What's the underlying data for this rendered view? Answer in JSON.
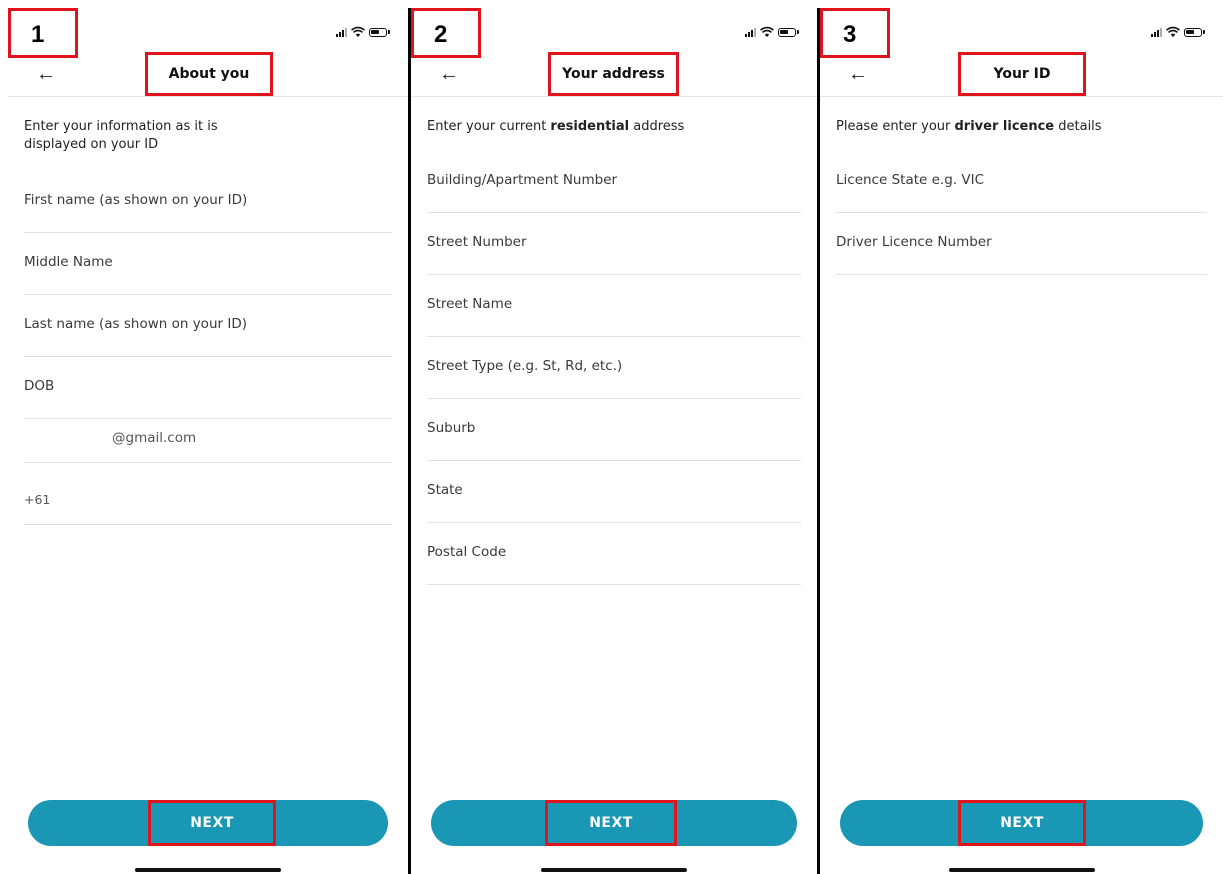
{
  "panels": [
    {
      "step": "1",
      "title": "About you",
      "intro": "Enter your information as it is displayed on your ID",
      "fields": [
        {
          "placeholder": "First name (as shown on your ID)"
        },
        {
          "placeholder": "Middle Name"
        },
        {
          "placeholder": "Last name (as shown on your ID)"
        },
        {
          "placeholder": "DOB"
        },
        {
          "value": "@gmail.com"
        },
        {
          "value": "+61"
        }
      ],
      "button": "NEXT"
    },
    {
      "step": "2",
      "title": "Your address",
      "intro_pre": "Enter your current ",
      "intro_bold": "residential",
      "intro_post": " address",
      "fields": [
        {
          "placeholder": "Building/Apartment Number"
        },
        {
          "placeholder": "Street Number"
        },
        {
          "placeholder": "Street Name"
        },
        {
          "placeholder": "Street Type (e.g. St, Rd, etc.)"
        },
        {
          "placeholder": "Suburb"
        },
        {
          "placeholder": "State"
        },
        {
          "placeholder": "Postal Code"
        }
      ],
      "button": "NEXT"
    },
    {
      "step": "3",
      "title": "Your ID",
      "intro_pre": "Please enter your ",
      "intro_bold": "driver licence",
      "intro_post": " details",
      "fields": [
        {
          "placeholder": "Licence State e.g. VIC"
        },
        {
          "placeholder": "Driver Licence Number"
        }
      ],
      "button": "NEXT"
    }
  ],
  "icons": {
    "back": "back-arrow-icon",
    "signal": "signal-icon",
    "wifi": "wifi-icon",
    "battery": "battery-icon"
  },
  "colors": {
    "accent": "#1a97b5",
    "highlight": "#e0141c"
  }
}
